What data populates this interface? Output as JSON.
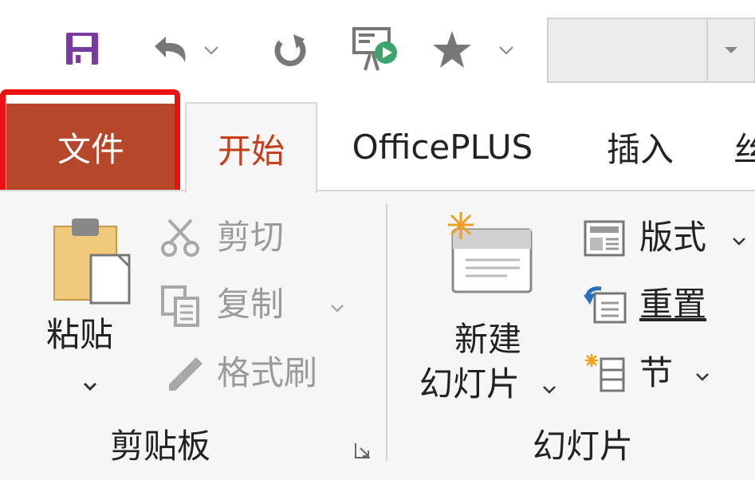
{
  "quick_access": {
    "icons": [
      "save-icon",
      "undo-icon",
      "redo-icon",
      "slideshow-icon",
      "star-icon"
    ],
    "font_box_value": ""
  },
  "tabs": [
    {
      "label": "文件",
      "active": false,
      "style": "file"
    },
    {
      "label": "开始",
      "active": true
    },
    {
      "label": "OfficePLUS",
      "active": false
    },
    {
      "label": "插入",
      "active": false
    },
    {
      "label": "丝",
      "active": false
    }
  ],
  "clipboard": {
    "paste_label": "粘贴",
    "cut_label": "剪切",
    "copy_label": "复制",
    "format_painter_label": "格式刷",
    "group_label": "剪贴板"
  },
  "slides": {
    "new_slide_line1": "新建",
    "new_slide_line2": "幻灯片",
    "layout_label": "版式",
    "reset_label": "重置",
    "section_label": "节",
    "group_label": "幻灯片"
  },
  "colors": {
    "file_tab": "#b7472a",
    "accent_text": "#c43e1c",
    "highlight_box": "#ee1111",
    "save_icon": "#7a3aa0"
  }
}
